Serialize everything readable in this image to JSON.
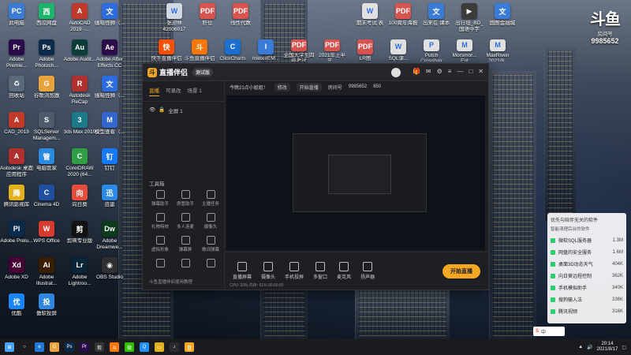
{
  "desktop": {
    "icons": [
      {
        "label": "此电脑",
        "color": "#3a7bd5",
        "glyph": "PC"
      },
      {
        "label": "西瓜网盘",
        "color": "#1bb46a",
        "glyph": "西"
      },
      {
        "label": "AutoCAD 2019 -...",
        "color": "#c0392b",
        "glyph": "A"
      },
      {
        "label": "幽暗怪狮（...",
        "color": "#2d6cdf",
        "glyph": "文"
      },
      {
        "label": "Adobe Premie...",
        "color": "#2a0a4a",
        "glyph": "Pr"
      },
      {
        "label": "Adobe Photosh...",
        "color": "#0c2a4a",
        "glyph": "Ps"
      },
      {
        "label": "Adobe Audit...",
        "color": "#0b3d3b",
        "glyph": "Au"
      },
      {
        "label": "Adobe After Effects CC",
        "color": "#2b0d4a",
        "glyph": "Ae"
      },
      {
        "label": "回收站",
        "color": "#5a6a7a",
        "glyph": "♻"
      },
      {
        "label": "谷歌浏览器",
        "color": "#e8a33d",
        "glyph": "G"
      },
      {
        "label": "Autodesk ReCap",
        "color": "#b03030",
        "glyph": "R"
      },
      {
        "label": "幽暗怪狮（...",
        "color": "#2d6cdf",
        "glyph": "文"
      },
      {
        "label": "CAD_2019",
        "color": "#c0392b",
        "glyph": "A"
      },
      {
        "label": "SQLServer Managem...",
        "color": "#4d5b6b",
        "glyph": "S"
      },
      {
        "label": "3ds Max 2019",
        "color": "#1b7a8a",
        "glyph": "3"
      },
      {
        "label": "模型查看（...",
        "color": "#3366cc",
        "glyph": "M"
      },
      {
        "label": "Autodesk 桌面应用程序",
        "color": "#b03030",
        "glyph": "A"
      },
      {
        "label": "电脑管家",
        "color": "#2a8ae0",
        "glyph": "管"
      },
      {
        "label": "CorelDRAW 2020 (64...",
        "color": "#2f9e44",
        "glyph": "C"
      },
      {
        "label": "钉钉",
        "color": "#1677ff",
        "glyph": "钉"
      },
      {
        "label": "腾讯影视库",
        "color": "#e3b21b",
        "glyph": "腾"
      },
      {
        "label": "Cinema 4D",
        "color": "#1e4fa0",
        "glyph": "C"
      },
      {
        "label": "向日葵",
        "color": "#e74c3c",
        "glyph": "向"
      },
      {
        "label": "迅雷",
        "color": "#2b8ae8",
        "glyph": "迅"
      },
      {
        "label": "Adobe Prelu...",
        "color": "#0a2a4a",
        "glyph": "Pl"
      },
      {
        "label": "WPS Office",
        "color": "#d63b2f",
        "glyph": "W"
      },
      {
        "label": "剪映专业版",
        "color": "#111111",
        "glyph": "剪"
      },
      {
        "label": "Adobe Dreamwe...",
        "color": "#0d3a1a",
        "glyph": "Dw"
      },
      {
        "label": "Adobe XD",
        "color": "#470137",
        "glyph": "Xd"
      },
      {
        "label": "Adobe Illustrat...",
        "color": "#3a1e00",
        "glyph": "Ai"
      },
      {
        "label": "Adobe Lightroo...",
        "color": "#0a2438",
        "glyph": "Lr"
      },
      {
        "label": "OBS Studio",
        "color": "#302e31",
        "glyph": "◉"
      },
      {
        "label": "优酷",
        "color": "#1a84ff",
        "glyph": "优"
      },
      {
        "label": "傲软投屏",
        "color": "#2e86de",
        "glyph": "投"
      }
    ],
    "top_row_right": [
      {
        "label": "张迎林 42006017",
        "color": "#cfd8e3",
        "glyph": "W"
      },
      {
        "label": "肝位",
        "color": "#d9534f",
        "glyph": "PDF"
      },
      {
        "label": "线性代数",
        "color": "#d9534f",
        "glyph": "PDF"
      },
      {
        "label": "期末考试 表",
        "color": "#e0e0e0",
        "glyph": "W"
      },
      {
        "label": "100周年海报",
        "color": "#d9534f",
        "glyph": "PDF"
      },
      {
        "label": "出来在 课本",
        "color": "#3a7bd5",
        "glyph": "文"
      },
      {
        "label": "出行坦_BD_ 国语中字",
        "color": "#3b3b3b",
        "glyph": "▶"
      },
      {
        "label": "国图金融城",
        "color": "#3a7bd5",
        "glyph": "文"
      }
    ],
    "second_row_right": [
      {
        "label": "快手直播伴侣",
        "color": "#ff5000",
        "glyph": "快"
      },
      {
        "label": "斗鱼直播伴侣",
        "color": "#ff7700",
        "glyph": "斗"
      },
      {
        "label": "ClickCharts",
        "color": "#1a6fcf",
        "glyph": "C"
      },
      {
        "label": "InletexEM...",
        "color": "#3a7bd5",
        "glyph": "I"
      },
      {
        "label": "全国大学生四级考试",
        "color": "#d9534f",
        "glyph": "PDF"
      },
      {
        "label": "2021年上半年...",
        "color": "#d9534f",
        "glyph": "PDF"
      },
      {
        "label": "LR图",
        "color": "#d9534f",
        "glyph": "PDF"
      },
      {
        "label": "SQL课...",
        "color": "#e0e0e0",
        "glyph": "W"
      },
      {
        "label": "Putch Crosshair",
        "color": "#e0e0e0",
        "glyph": "P"
      },
      {
        "label": "Morsmor... Ent",
        "color": "#e0e0e0",
        "glyph": "M"
      },
      {
        "label": "MaxRiven 2021/8..",
        "color": "#e0e0e0",
        "glyph": "M"
      }
    ]
  },
  "app": {
    "name": "直播伴侣",
    "version": "测试版",
    "sidebar_tabs": [
      "直播",
      "可录改",
      "场景 1"
    ],
    "scene_label": "全屏 1",
    "tools_title": "工具箱",
    "tools": [
      "弹幕助手",
      "房管助手",
      "主播任务",
      "礼物特效",
      "多人连麦",
      "摄像头",
      "虚拟形象",
      "弹幕屏",
      "歌词弹幕",
      "",
      "",
      ""
    ],
    "footer_note": "斗鱼直播伴侣使用教程",
    "topbar": {
      "left": "今晚21点小姐姐！",
      "pill1": "修改",
      "pill2": "开始直播",
      "room_label": "房间号",
      "room_id": "9985652",
      "viewers": "850"
    },
    "bottom_items": [
      "直播屏幕",
      "摄像头",
      "手机投屏",
      "多窗口",
      "麦克风",
      "扬声器"
    ],
    "go_live": "开始直播",
    "status": "CPU: 33%  内存: 61%   00:00:00"
  },
  "badge": {
    "big": "斗鱼",
    "small": "房间号",
    "num": "9985652"
  },
  "notification": {
    "title": "优先与陪伴无关的软件",
    "subtitle": "智能清理后台的软件",
    "rows": [
      {
        "name": "微软SQL服务器",
        "value": "1.3M"
      },
      {
        "name": "网盘的安全服务",
        "value": "1.6M"
      },
      {
        "name": "桌面3D动态天气",
        "value": "404K"
      },
      {
        "name": "向日葵远程控制",
        "value": "362K"
      },
      {
        "name": "手机模拟助手",
        "value": "340K"
      },
      {
        "name": "搜狗输入法",
        "value": "336K"
      },
      {
        "name": "腾讯视频",
        "value": "316K"
      }
    ]
  },
  "taskbar": {
    "icons": [
      {
        "name": "start",
        "color": "#4aa3ff",
        "glyph": "⊞"
      },
      {
        "name": "search",
        "color": "#1a1b1f",
        "glyph": "○"
      },
      {
        "name": "edge",
        "color": "#1f7ad6",
        "glyph": "e"
      },
      {
        "name": "chrome",
        "color": "#e8a33d",
        "glyph": "G"
      },
      {
        "name": "photoshop",
        "color": "#0c2a4a",
        "glyph": "Ps"
      },
      {
        "name": "premiere",
        "color": "#2a0a4a",
        "glyph": "Pr"
      },
      {
        "name": "capcut",
        "color": "#333",
        "glyph": "剪"
      },
      {
        "name": "douyu",
        "color": "#ff7700",
        "glyph": "斗"
      },
      {
        "name": "wechat",
        "color": "#2dc100",
        "glyph": "微"
      },
      {
        "name": "qq",
        "color": "#1e90ff",
        "glyph": "Q"
      },
      {
        "name": "folder",
        "color": "#e3b21b",
        "glyph": "▭"
      },
      {
        "name": "music",
        "color": "#2a2b30",
        "glyph": "♪"
      },
      {
        "name": "live",
        "color": "#f5a623",
        "glyph": "直"
      }
    ],
    "time": "20:14",
    "date": "2021/8/17",
    "ime": "中"
  }
}
